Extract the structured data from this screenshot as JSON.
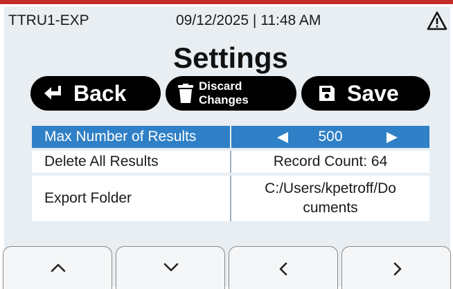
{
  "status": {
    "device_name": "TTRU1-EXP",
    "datetime": "09/12/2025 | 11:48 AM",
    "warning_icon": "warning-triangle-icon"
  },
  "page": {
    "title": "Settings"
  },
  "toolbar": {
    "back_label": "Back",
    "discard_line1": "Discard",
    "discard_line2": "Changes",
    "save_label": "Save",
    "back_icon": "return-arrow-icon",
    "discard_icon": "trash-icon",
    "save_icon": "floppy-disk-icon"
  },
  "settings": [
    {
      "label": "Max Number of Results",
      "value": "500",
      "selected": true
    },
    {
      "label": "Delete All Results",
      "value": "Record Count: 64"
    },
    {
      "label": "Export Folder",
      "value_line1": "C:/Users/kpetroff/Do",
      "value_line2": "cuments"
    }
  ],
  "nav": {
    "buttons": [
      "chevron-up-icon",
      "chevron-down-icon",
      "chevron-left-icon",
      "chevron-right-icon"
    ]
  },
  "colors": {
    "accent_red": "#c42b2b",
    "selection_blue": "#2f80c6",
    "background": "#e8eef2",
    "button_black": "#000000"
  }
}
